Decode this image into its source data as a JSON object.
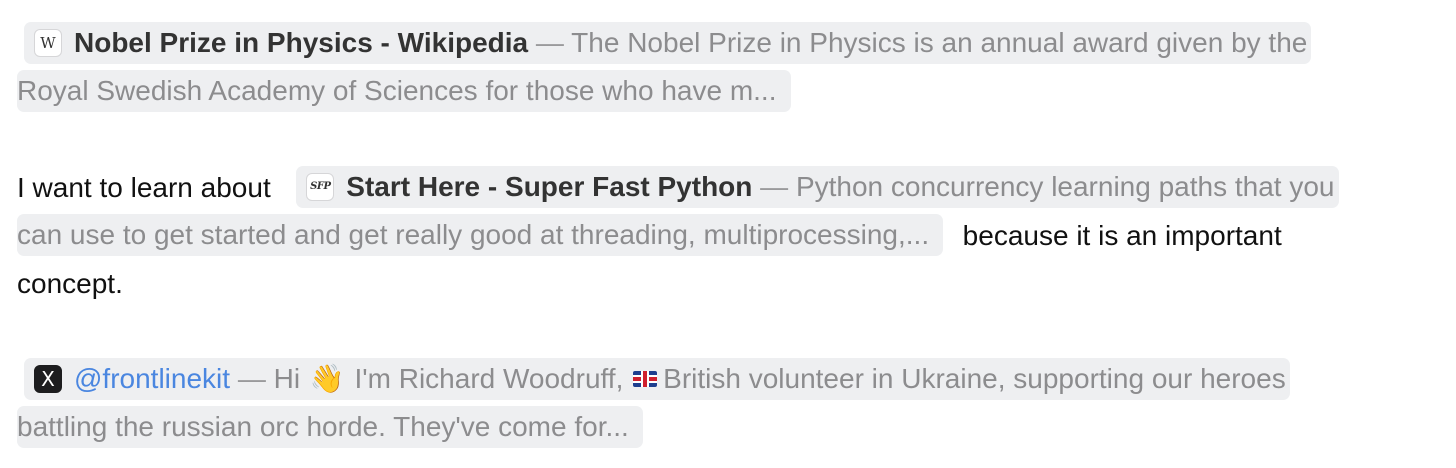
{
  "links": [
    {
      "icon": "wikipedia-icon",
      "favicon_text": "W",
      "title": "Nobel Prize in Physics - Wikipedia",
      "separator": " — ",
      "desc_part1": "The Nobel Prize in Physics is an annual award given by the",
      "desc_part2": "Royal Swedish Academy of Sciences for those who have m..."
    },
    {
      "icon": "superfastpython-icon",
      "favicon_text": "SFP",
      "title": "Start Here - Super Fast Python",
      "separator": " — ",
      "desc_part1": "Python concurrency learning paths that you",
      "desc_part2": "can use to get started and get really good at threading, multiprocessing,..."
    },
    {
      "icon": "x-icon",
      "favicon_text": "X",
      "title": "@frontlinekit",
      "separator": " — ",
      "desc_a": "Hi ",
      "wave": "👋",
      "desc_b": " I'm Richard Woodruff, ",
      "flag": "uk-flag-icon",
      "desc_c": "British volunteer in Ukraine, supporting our heroes",
      "desc_part2": "battling the russian orc horde. They've come for..."
    }
  ],
  "sentence": {
    "before": "I want to learn about",
    "after": "because it is an important",
    "end": "concept."
  },
  "colors": {
    "chip_background": "#eeeff1",
    "title": "#333333",
    "description": "#8c8c8e",
    "handle": "#4a86e0"
  }
}
